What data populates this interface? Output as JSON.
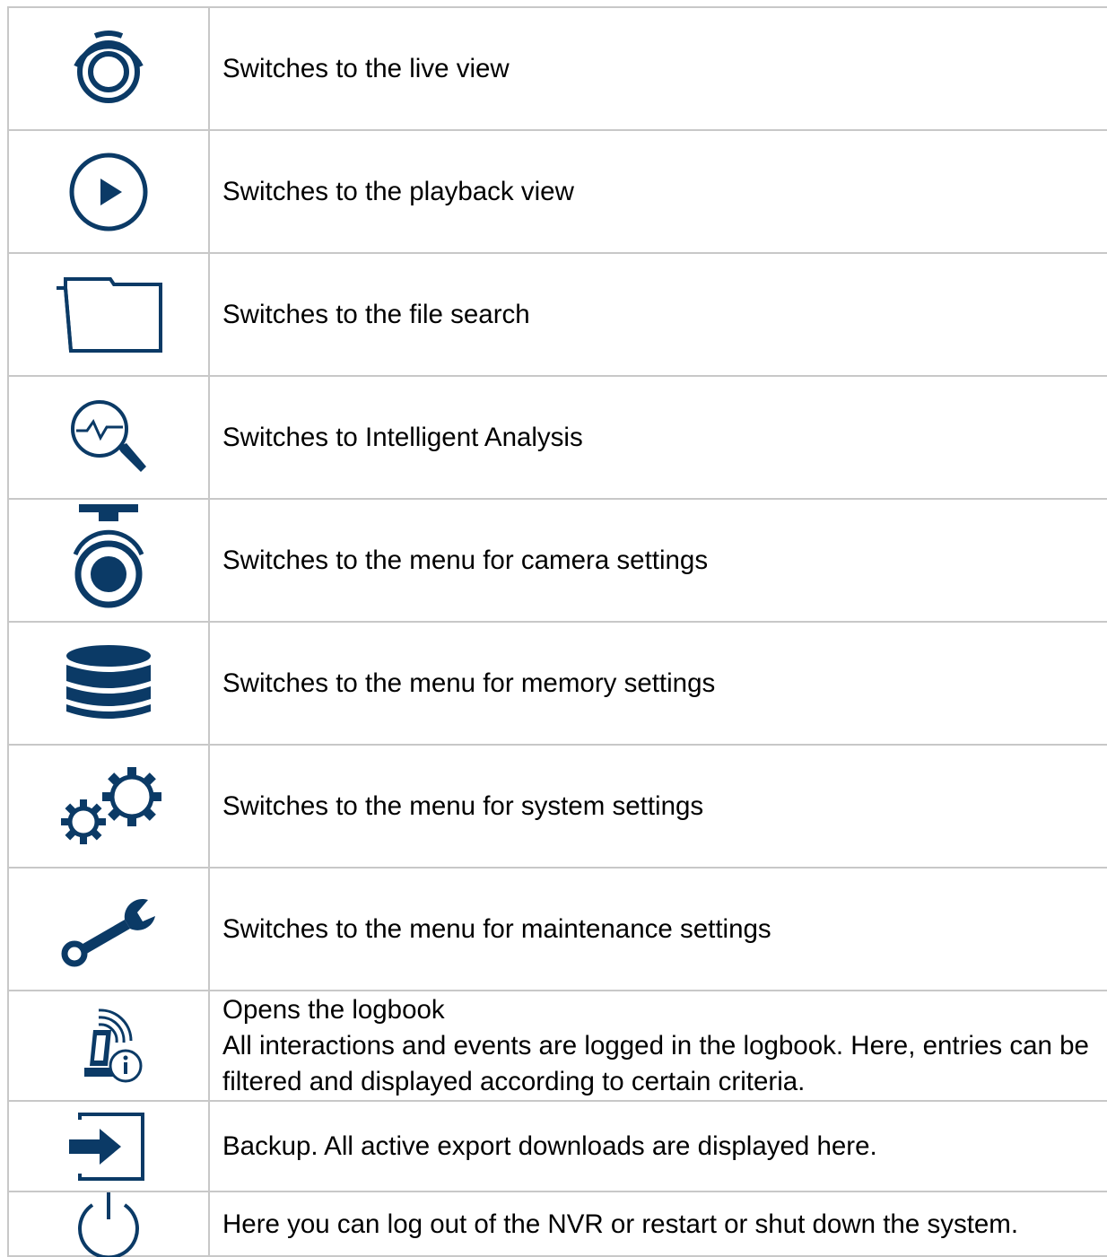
{
  "icon_color": "#0b3a66",
  "rows": [
    {
      "icon": "live-view-icon",
      "text": "Switches to the live view"
    },
    {
      "icon": "playback-icon",
      "text": "Switches to the playback view"
    },
    {
      "icon": "folder-icon",
      "text": "Switches to the file search"
    },
    {
      "icon": "analysis-search-icon",
      "text": "Switches to Intelligent Analysis"
    },
    {
      "icon": "camera-icon",
      "text": "Switches to the menu for camera settings"
    },
    {
      "icon": "database-icon",
      "text": "Switches to the menu for memory settings"
    },
    {
      "icon": "gears-icon",
      "text": "Switches to the menu for system settings"
    },
    {
      "icon": "wrench-icon",
      "text": "Switches to the menu for maintenance settings"
    },
    {
      "icon": "logbook-icon",
      "text": "Opens the logbook",
      "text2": "All interactions and events are logged in the logbook. Here, entries can be filtered and displayed according to certain criteria."
    },
    {
      "icon": "backup-icon",
      "text": "Backup. All active export downloads are displayed here."
    },
    {
      "icon": "power-icon",
      "text": "Here you can log out of the NVR or restart or shut down the system."
    }
  ]
}
